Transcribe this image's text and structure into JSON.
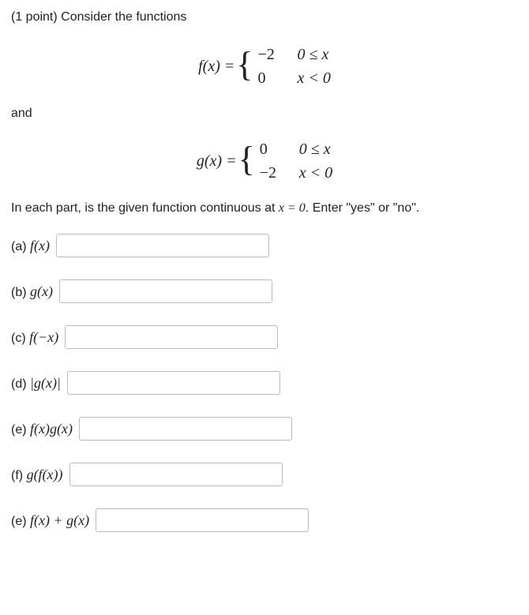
{
  "header": {
    "points": "(1 point)",
    "intro": "Consider the functions"
  },
  "eq_f": {
    "left": "f(x) = ",
    "r1_val": "−2",
    "r1_cond": "0 ≤ x",
    "r2_val": "0",
    "r2_cond": "x < 0"
  },
  "connector": "and",
  "eq_g": {
    "left": "g(x) = ",
    "r1_val": "0",
    "r1_cond": "0 ≤ x",
    "r2_val": "−2",
    "r2_cond": "x < 0"
  },
  "instruction": {
    "pre": "In each part, is the given function continuous at ",
    "var": "x = 0",
    "post": ". Enter \"yes\" or \"no\"."
  },
  "parts": {
    "a": {
      "label": "(a)",
      "fn": "f(x)"
    },
    "b": {
      "label": "(b)",
      "fn": "g(x)"
    },
    "c": {
      "label": "(c)",
      "fn": "f(−x)"
    },
    "d": {
      "label": "(d)",
      "fn": "|g(x)|"
    },
    "e": {
      "label": "(e)",
      "fn": "f(x)g(x)"
    },
    "f": {
      "label": "(f)",
      "fn": "g(f(x))"
    },
    "g": {
      "label": "(e)",
      "fn": "f(x) + g(x)"
    }
  }
}
